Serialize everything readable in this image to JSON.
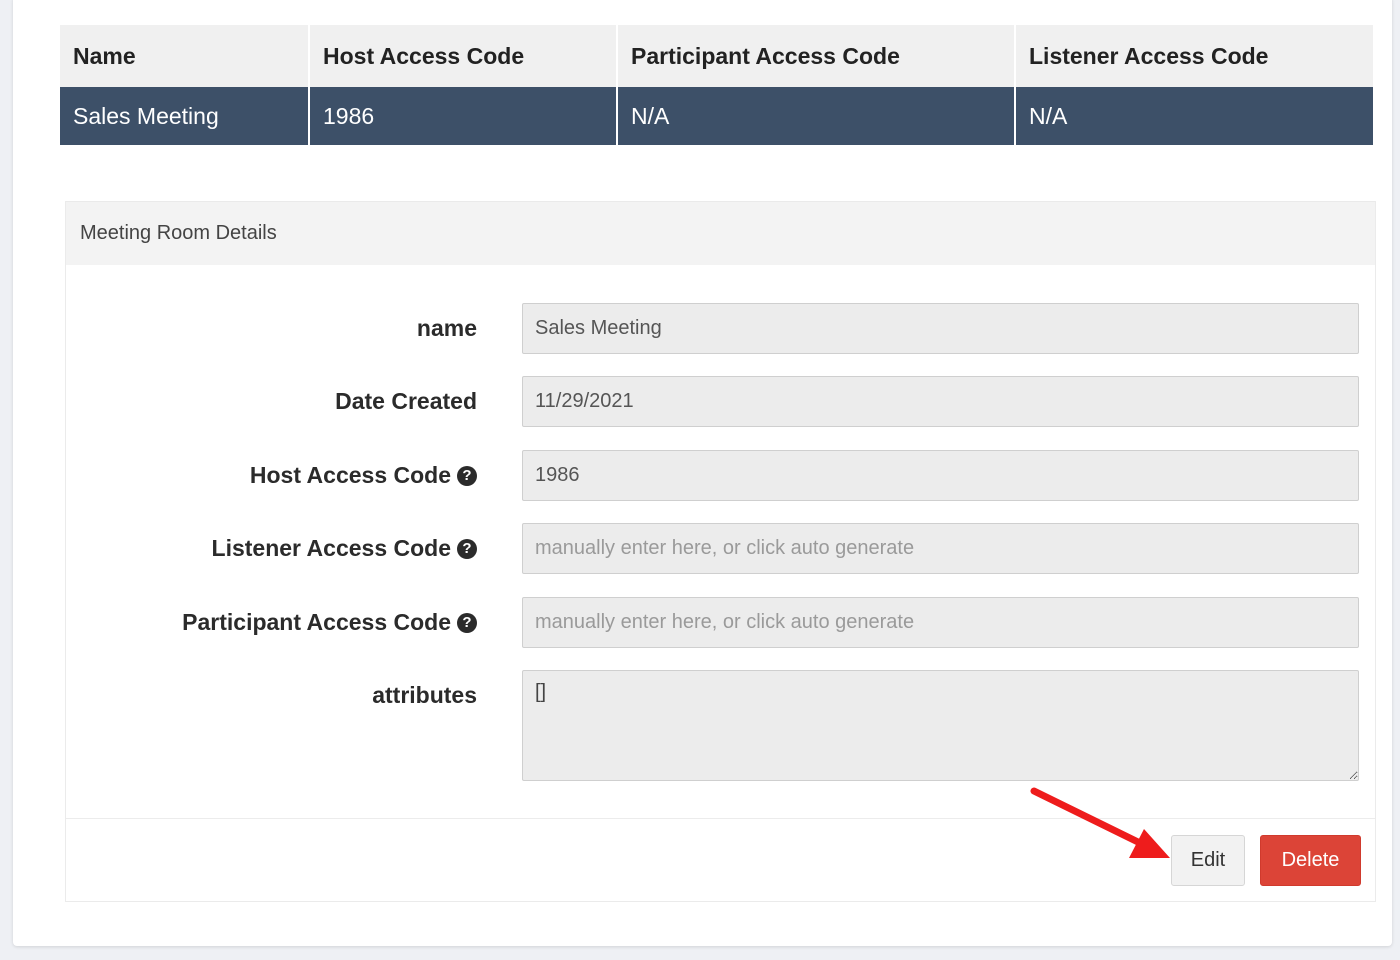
{
  "table": {
    "headers": [
      "Name",
      "Host Access Code",
      "Participant Access Code",
      "Listener Access Code"
    ],
    "rows": [
      [
        "Sales Meeting",
        "1986",
        "N/A",
        "N/A"
      ]
    ]
  },
  "details": {
    "heading": "Meeting Room Details",
    "fields": {
      "name": {
        "label": "name",
        "value": "Sales Meeting"
      },
      "date_created": {
        "label": "Date Created",
        "value": "11/29/2021"
      },
      "host_code": {
        "label": "Host Access Code",
        "value": "1986"
      },
      "listener_code": {
        "label": "Listener Access Code",
        "value": "",
        "placeholder": "manually enter here, or click auto generate"
      },
      "participant_code": {
        "label": "Participant Access Code",
        "value": "",
        "placeholder": "manually enter here, or click auto generate"
      },
      "attributes": {
        "label": "attributes",
        "value": "[]"
      }
    },
    "help_icon_glyph": "?",
    "buttons": {
      "edit": "Edit",
      "delete": "Delete"
    }
  },
  "colors": {
    "selected_row": "#3d5068",
    "delete_button": "#dc4437",
    "annotation_arrow": "#ee1c1c"
  },
  "icons": {
    "help": "question-circle-icon",
    "annotation": "red-arrow-annotation"
  }
}
